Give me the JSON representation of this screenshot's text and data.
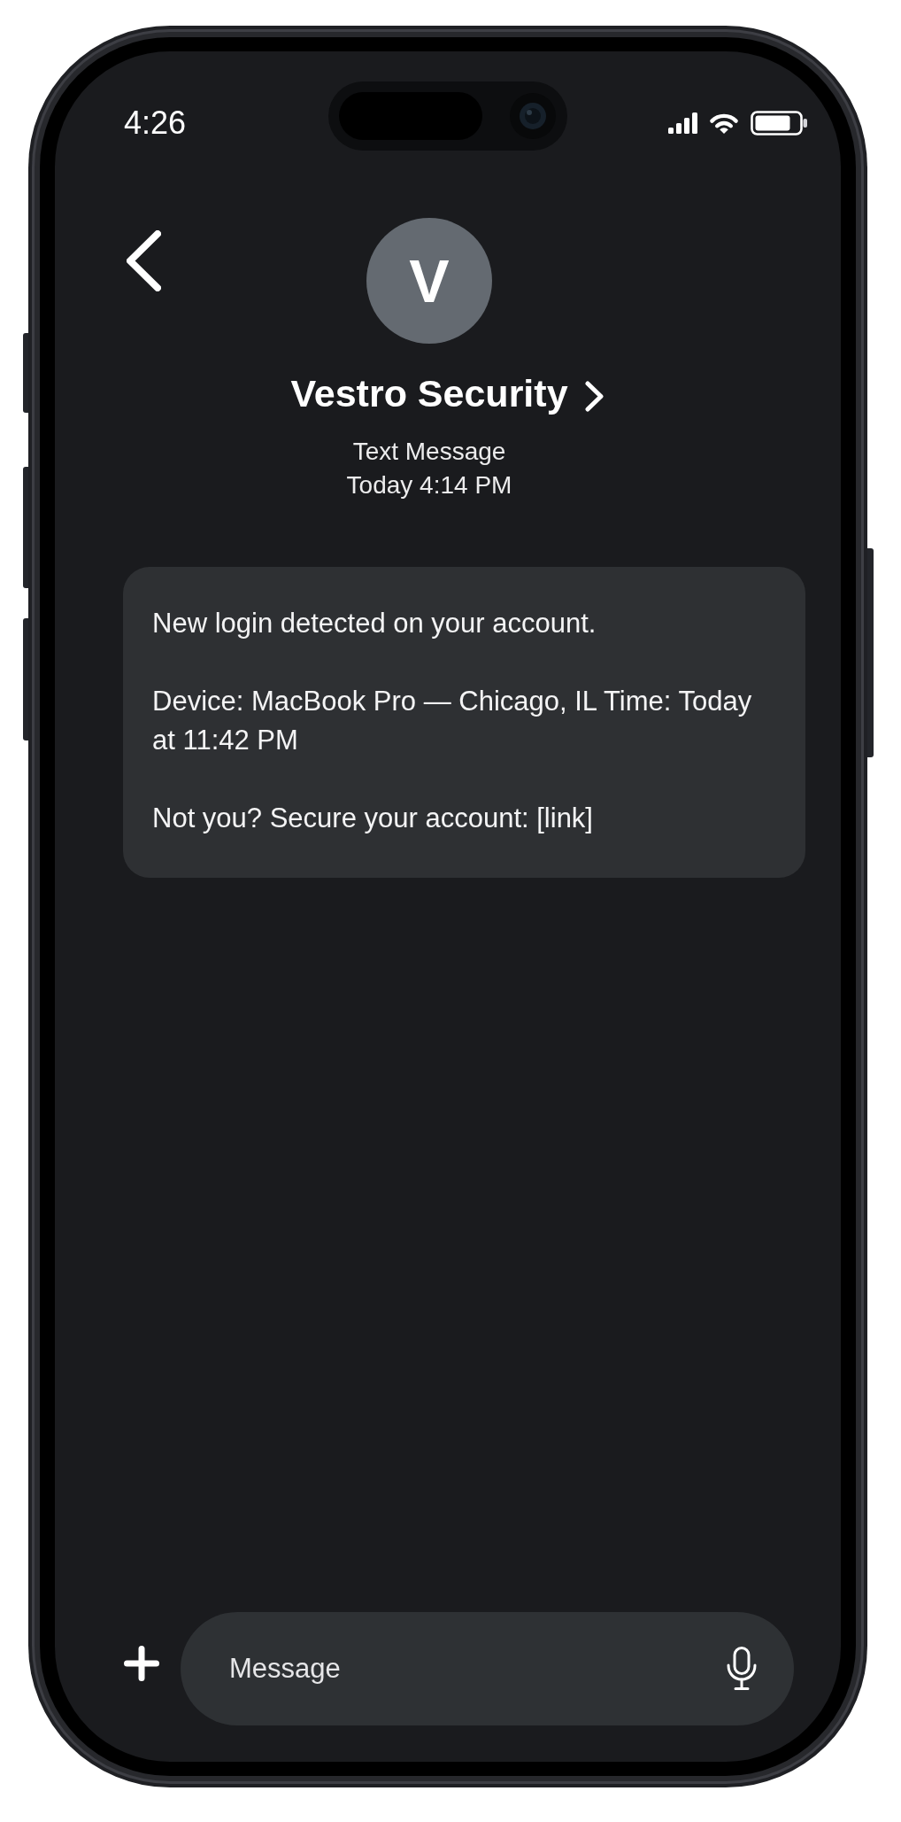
{
  "status_bar": {
    "time": "4:26"
  },
  "header": {
    "avatar_initial": "V",
    "contact_name": "Vestro Security",
    "subtitle": "Text Message",
    "timestamp": "Today 4:14 PM"
  },
  "messages": [
    {
      "paragraphs": [
        "New login detected on your account.",
        "Device: MacBook Pro — Chicago, IL Time: Today at 11:42 PM",
        "Not you? Secure your account: [link]"
      ]
    }
  ],
  "composer": {
    "placeholder": "Message"
  }
}
